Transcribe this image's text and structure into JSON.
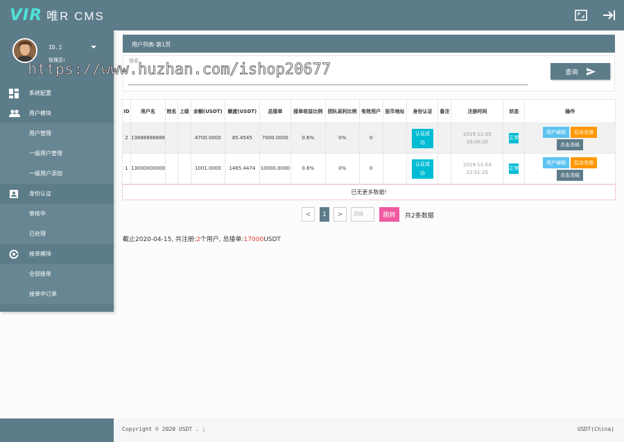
{
  "app": {
    "logo_mark": "VIR",
    "logo_text": "唯R CMS"
  },
  "user": {
    "id": "ID.1",
    "role": "管理员!"
  },
  "watermark": "https://www.huzhan.com/ishop20677",
  "sidebar": {
    "items": [
      {
        "label": "系统配置",
        "type": "group",
        "icon": "dashboard-icon"
      },
      {
        "label": "用户模块",
        "type": "group",
        "icon": "people-icon"
      },
      {
        "label": "用户管理",
        "type": "sub"
      },
      {
        "label": "一级用户管理",
        "type": "sub"
      },
      {
        "label": "一级用户添加",
        "type": "sub"
      },
      {
        "label": "身份认证",
        "type": "group",
        "icon": "id-card-icon"
      },
      {
        "label": "审核中",
        "type": "sub"
      },
      {
        "label": "已处理",
        "type": "sub"
      },
      {
        "label": "接单模块",
        "type": "group",
        "icon": "at-icon"
      },
      {
        "label": "全部接单",
        "type": "sub"
      },
      {
        "label": "接单中订单",
        "type": "sub"
      }
    ]
  },
  "panel": {
    "title": "用户列表-第1页"
  },
  "search": {
    "label": "搜索",
    "placeholder": "",
    "button": "查询"
  },
  "table": {
    "headers": [
      "ID",
      "用户名",
      "姓名",
      "上级",
      "余额(USDT)",
      "额度(USDT)",
      "总接单",
      "接单收益比例",
      "团队返利比例",
      "有效用户",
      "投币地址",
      "身份认证",
      "备注",
      "注册时间",
      "状态",
      "操作"
    ],
    "rows": [
      {
        "id": "2",
        "username": "13888888888",
        "name": "",
        "parent": "",
        "balance": "4700.0000",
        "quota": "85.4545",
        "total": "7000.0000",
        "ratio": "0.6%",
        "team": "0%",
        "valid": "0",
        "addr": "",
        "auth": "认证成功",
        "note": "",
        "reg_date": "2019-11-05",
        "reg_time": "16:00:20",
        "status": "正常"
      },
      {
        "id": "1",
        "username": "13000000000",
        "name": "",
        "parent": "",
        "balance": "1001.0000",
        "quota": "1465.4474",
        "total": "10000.0000",
        "ratio": "0.6%",
        "team": "0%",
        "valid": "0",
        "addr": "",
        "auth": "认证成功",
        "note": "",
        "reg_date": "2019-11-04",
        "reg_time": "22:51:25",
        "status": "正常"
      }
    ],
    "actions": {
      "edit": "用户编辑",
      "charge": "后台充值",
      "freeze": "点击冻结"
    },
    "empty": "已无更多数据!"
  },
  "pagination": {
    "prev": "<",
    "current": "1",
    "next": ">",
    "page_input": "页码",
    "jump": "跳转",
    "total": "共2条数据"
  },
  "summary": {
    "prefix": "截止2020-04-15, 共注册:",
    "count": "2",
    "mid": "个用户, 总接单:",
    "amount": "17000",
    "unit": "USDT"
  },
  "footer": {
    "copyright": "Copyright © 2020 USDT . ;",
    "region": "USDT(China)"
  },
  "colors": {
    "primary": "#5d7c8a",
    "accent": "#4fe3d7",
    "badge": "#00bcd4",
    "orange": "#ff9800",
    "blue": "#5cc3f0",
    "pink": "#ef5aa0",
    "red": "#e53935"
  }
}
